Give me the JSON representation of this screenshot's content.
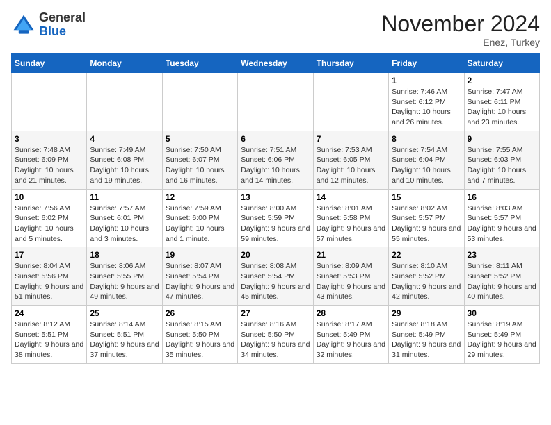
{
  "logo": {
    "general": "General",
    "blue": "Blue"
  },
  "header": {
    "month": "November 2024",
    "location": "Enez, Turkey"
  },
  "weekdays": [
    "Sunday",
    "Monday",
    "Tuesday",
    "Wednesday",
    "Thursday",
    "Friday",
    "Saturday"
  ],
  "weeks": [
    [
      {
        "day": "",
        "info": ""
      },
      {
        "day": "",
        "info": ""
      },
      {
        "day": "",
        "info": ""
      },
      {
        "day": "",
        "info": ""
      },
      {
        "day": "",
        "info": ""
      },
      {
        "day": "1",
        "info": "Sunrise: 7:46 AM\nSunset: 6:12 PM\nDaylight: 10 hours and 26 minutes."
      },
      {
        "day": "2",
        "info": "Sunrise: 7:47 AM\nSunset: 6:11 PM\nDaylight: 10 hours and 23 minutes."
      }
    ],
    [
      {
        "day": "3",
        "info": "Sunrise: 7:48 AM\nSunset: 6:09 PM\nDaylight: 10 hours and 21 minutes."
      },
      {
        "day": "4",
        "info": "Sunrise: 7:49 AM\nSunset: 6:08 PM\nDaylight: 10 hours and 19 minutes."
      },
      {
        "day": "5",
        "info": "Sunrise: 7:50 AM\nSunset: 6:07 PM\nDaylight: 10 hours and 16 minutes."
      },
      {
        "day": "6",
        "info": "Sunrise: 7:51 AM\nSunset: 6:06 PM\nDaylight: 10 hours and 14 minutes."
      },
      {
        "day": "7",
        "info": "Sunrise: 7:53 AM\nSunset: 6:05 PM\nDaylight: 10 hours and 12 minutes."
      },
      {
        "day": "8",
        "info": "Sunrise: 7:54 AM\nSunset: 6:04 PM\nDaylight: 10 hours and 10 minutes."
      },
      {
        "day": "9",
        "info": "Sunrise: 7:55 AM\nSunset: 6:03 PM\nDaylight: 10 hours and 7 minutes."
      }
    ],
    [
      {
        "day": "10",
        "info": "Sunrise: 7:56 AM\nSunset: 6:02 PM\nDaylight: 10 hours and 5 minutes."
      },
      {
        "day": "11",
        "info": "Sunrise: 7:57 AM\nSunset: 6:01 PM\nDaylight: 10 hours and 3 minutes."
      },
      {
        "day": "12",
        "info": "Sunrise: 7:59 AM\nSunset: 6:00 PM\nDaylight: 10 hours and 1 minute."
      },
      {
        "day": "13",
        "info": "Sunrise: 8:00 AM\nSunset: 5:59 PM\nDaylight: 9 hours and 59 minutes."
      },
      {
        "day": "14",
        "info": "Sunrise: 8:01 AM\nSunset: 5:58 PM\nDaylight: 9 hours and 57 minutes."
      },
      {
        "day": "15",
        "info": "Sunrise: 8:02 AM\nSunset: 5:57 PM\nDaylight: 9 hours and 55 minutes."
      },
      {
        "day": "16",
        "info": "Sunrise: 8:03 AM\nSunset: 5:57 PM\nDaylight: 9 hours and 53 minutes."
      }
    ],
    [
      {
        "day": "17",
        "info": "Sunrise: 8:04 AM\nSunset: 5:56 PM\nDaylight: 9 hours and 51 minutes."
      },
      {
        "day": "18",
        "info": "Sunrise: 8:06 AM\nSunset: 5:55 PM\nDaylight: 9 hours and 49 minutes."
      },
      {
        "day": "19",
        "info": "Sunrise: 8:07 AM\nSunset: 5:54 PM\nDaylight: 9 hours and 47 minutes."
      },
      {
        "day": "20",
        "info": "Sunrise: 8:08 AM\nSunset: 5:54 PM\nDaylight: 9 hours and 45 minutes."
      },
      {
        "day": "21",
        "info": "Sunrise: 8:09 AM\nSunset: 5:53 PM\nDaylight: 9 hours and 43 minutes."
      },
      {
        "day": "22",
        "info": "Sunrise: 8:10 AM\nSunset: 5:52 PM\nDaylight: 9 hours and 42 minutes."
      },
      {
        "day": "23",
        "info": "Sunrise: 8:11 AM\nSunset: 5:52 PM\nDaylight: 9 hours and 40 minutes."
      }
    ],
    [
      {
        "day": "24",
        "info": "Sunrise: 8:12 AM\nSunset: 5:51 PM\nDaylight: 9 hours and 38 minutes."
      },
      {
        "day": "25",
        "info": "Sunrise: 8:14 AM\nSunset: 5:51 PM\nDaylight: 9 hours and 37 minutes."
      },
      {
        "day": "26",
        "info": "Sunrise: 8:15 AM\nSunset: 5:50 PM\nDaylight: 9 hours and 35 minutes."
      },
      {
        "day": "27",
        "info": "Sunrise: 8:16 AM\nSunset: 5:50 PM\nDaylight: 9 hours and 34 minutes."
      },
      {
        "day": "28",
        "info": "Sunrise: 8:17 AM\nSunset: 5:49 PM\nDaylight: 9 hours and 32 minutes."
      },
      {
        "day": "29",
        "info": "Sunrise: 8:18 AM\nSunset: 5:49 PM\nDaylight: 9 hours and 31 minutes."
      },
      {
        "day": "30",
        "info": "Sunrise: 8:19 AM\nSunset: 5:49 PM\nDaylight: 9 hours and 29 minutes."
      }
    ]
  ]
}
